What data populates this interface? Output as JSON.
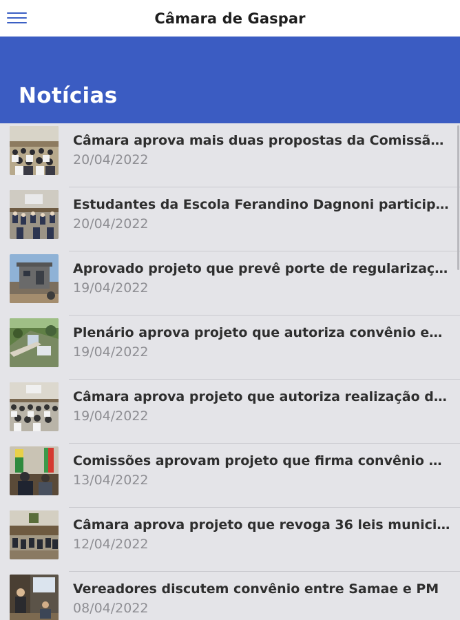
{
  "app_bar": {
    "title": "Câmara de Gaspar",
    "menu_icon": "hamburger-menu-icon"
  },
  "hero": {
    "title": "Notícias"
  },
  "colors": {
    "accent": "#3b5cc2",
    "background": "#e4e4e8",
    "title_text": "#2e2e2e",
    "date_text": "#8e8e93"
  },
  "news": [
    {
      "title": "Câmara aprova mais duas propostas da Comissão ...",
      "date": "20/04/2022",
      "image": "photo-plenary-audience"
    },
    {
      "title": "Estudantes da Escola Ferandino Dagnoni particip...",
      "date": "20/04/2022",
      "image": "photo-students-in-chamber"
    },
    {
      "title": "Aprovado projeto que prevê porte de regularizaçã...",
      "date": "19/04/2022",
      "image": "photo-building-exterior"
    },
    {
      "title": "Plenário aprova projeto que autoriza convênio ent...",
      "date": "19/04/2022",
      "image": "photo-aerial-view"
    },
    {
      "title": "Câmara aprova projeto que autoriza realização de ...",
      "date": "19/04/2022",
      "image": "photo-session-audience"
    },
    {
      "title": "Comissões aprovam projeto que firma convênio e...",
      "date": "13/04/2022",
      "image": "photo-committee-meeting"
    },
    {
      "title": "Câmara aprova projeto que revoga 36 leis municip...",
      "date": "12/04/2022",
      "image": "photo-plenary-session"
    },
    {
      "title": "Vereadores discutem convênio entre Samae e PM",
      "date": "08/04/2022",
      "image": "photo-meeting-presentation"
    }
  ]
}
